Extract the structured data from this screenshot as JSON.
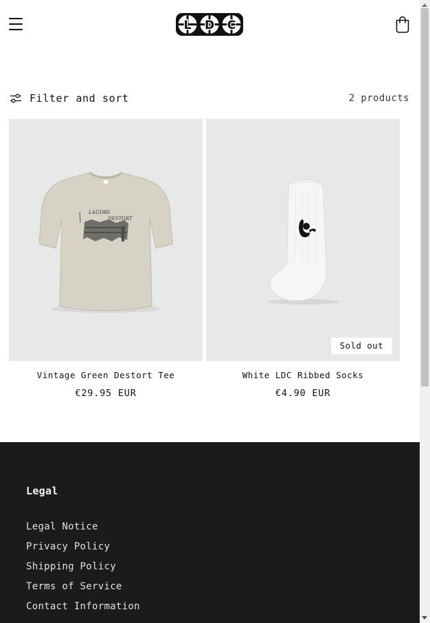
{
  "header": {
    "menu_icon": "hamburger-menu-icon",
    "logo_text": "LDC",
    "cart_icon": "shopping-bag-icon"
  },
  "toolbar": {
    "filter_icon": "sliders-icon",
    "filter_label": "Filter and sort",
    "product_count": "2 products"
  },
  "products": [
    {
      "name": "Vintage Green Destort Tee",
      "price": "€29.95 EUR",
      "image": "t-shirt-image",
      "image_text": "LAUDRE DESTORT"
    },
    {
      "name": "White LDC Ribbed Socks",
      "price": "€4.90 EUR",
      "image": "sock-image",
      "badge": "Sold out"
    }
  ],
  "footer": {
    "heading": "Legal",
    "links": [
      "Legal Notice",
      "Privacy Policy",
      "Shipping Policy",
      "Terms of Service",
      "Contact Information"
    ]
  },
  "colors": {
    "background": "#ffffff",
    "text": "#121212",
    "card_background": "#e8e8e8",
    "footer_background": "#1b1b1c",
    "footer_text": "#e2e2e2",
    "tee": "#d6d3c6",
    "sock": "#f6f6f6"
  }
}
